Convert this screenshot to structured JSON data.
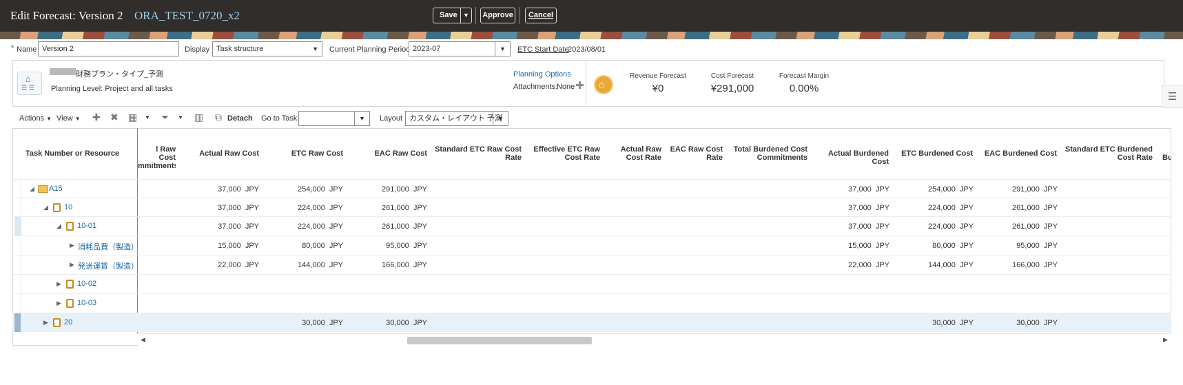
{
  "header": {
    "title": "Edit Forecast: Version 2",
    "project": "ORA_TEST_0720_x2",
    "save_label": "Save",
    "approve_label": "Approve",
    "cancel_label": "Cancel"
  },
  "form": {
    "required_mark": "*",
    "name_label": "Name",
    "name_value": "Version 2",
    "display_label": "Display",
    "display_value": "Task structure",
    "period_label": "Current Planning Period",
    "period_value": "2023-07",
    "etc_label": "ETC Start Date",
    "etc_value": "2023/08/01"
  },
  "info": {
    "plan_type": "財務プラン・タイプ_予測",
    "planning_level": "Planning Level: Project and all tasks",
    "planning_options": "Planning Options",
    "attachments_label": "Attachments:",
    "attachments_value": "None",
    "revenue_label": "Revenue Forecast",
    "revenue_value": "¥0",
    "cost_label": "Cost Forecast",
    "cost_value": "¥291,000",
    "margin_label": "Forecast Margin",
    "margin_value": "0.00%"
  },
  "toolbar": {
    "actions": "Actions",
    "view": "View",
    "detach": "Detach",
    "goto_label": "Go to Task",
    "goto_value": "",
    "layout_label": "Layout",
    "layout_value": "カスタム・レイアウト 予測"
  },
  "table": {
    "first_col": "Task Number or Resource",
    "columns": [
      {
        "l1": "l Raw Cost",
        "l2": "mmitments"
      },
      {
        "l1": "Actual Raw Cost",
        "l2": ""
      },
      {
        "l1": "ETC Raw Cost",
        "l2": ""
      },
      {
        "l1": "EAC Raw Cost",
        "l2": ""
      },
      {
        "l1": "Standard ETC Raw Cost",
        "l2": "Rate"
      },
      {
        "l1": "Effective ETC Raw",
        "l2": "Cost Rate"
      },
      {
        "l1": "Actual Raw",
        "l2": "Cost Rate"
      },
      {
        "l1": "EAC Raw Cost",
        "l2": "Rate"
      },
      {
        "l1": "Total Burdened Cost",
        "l2": "Commitments"
      },
      {
        "l1": "Actual Burdened Cost",
        "l2": ""
      },
      {
        "l1": "ETC Burdened Cost",
        "l2": ""
      },
      {
        "l1": "EAC Burdened Cost",
        "l2": ""
      },
      {
        "l1": "Standard ETC Burdened",
        "l2": "Cost Rate"
      },
      {
        "l1": "Bu",
        "l2": ""
      }
    ],
    "currency": "JPY",
    "rows": [
      {
        "name": "A15",
        "actual": "37,000",
        "etc": "254,000",
        "eac": "291,000",
        "b_actual": "37,000",
        "b_etc": "254,000",
        "b_eac": "291,000"
      },
      {
        "name": "10",
        "actual": "37,000",
        "etc": "224,000",
        "eac": "261,000",
        "b_actual": "37,000",
        "b_etc": "224,000",
        "b_eac": "261,000"
      },
      {
        "name": "10-01",
        "actual": "37,000",
        "etc": "224,000",
        "eac": "261,000",
        "b_actual": "37,000",
        "b_etc": "224,000",
        "b_eac": "261,000"
      },
      {
        "name": "消耗品費（製造）",
        "actual": "15,000",
        "etc": "80,000",
        "eac": "95,000",
        "b_actual": "15,000",
        "b_etc": "80,000",
        "b_eac": "95,000"
      },
      {
        "name": "発送運賃（製造）",
        "actual": "22,000",
        "etc": "144,000",
        "eac": "166,000",
        "b_actual": "22,000",
        "b_etc": "144,000",
        "b_eac": "166,000"
      },
      {
        "name": "10-02"
      },
      {
        "name": "10-03"
      },
      {
        "name": "20",
        "etc": "30,000",
        "eac": "30,000",
        "b_etc": "30,000",
        "b_eac": "30,000"
      }
    ]
  }
}
